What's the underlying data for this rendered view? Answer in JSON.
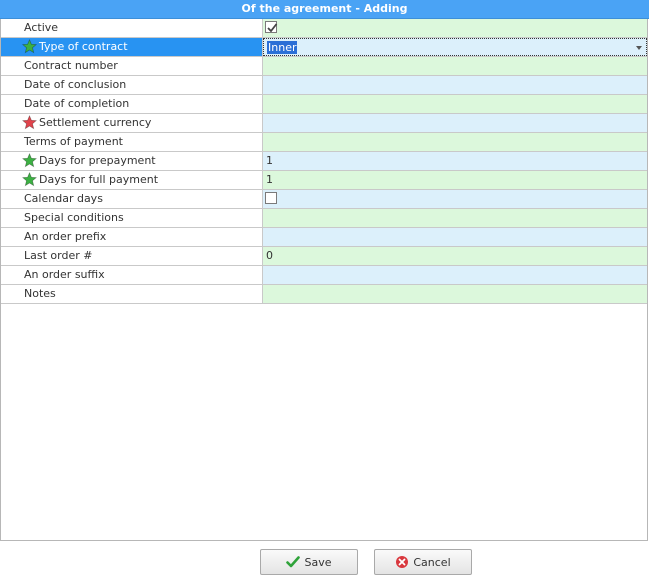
{
  "window": {
    "title": "Of the agreement - Adding"
  },
  "fields": [
    {
      "label": "Active",
      "value": "",
      "type": "checkbox",
      "checked": true,
      "icon": "",
      "bg": "green"
    },
    {
      "label": "Type of contract",
      "value": "Inner",
      "type": "select",
      "icon": "star-green-icon",
      "bg": "blue",
      "selected": true
    },
    {
      "label": "Contract number",
      "value": "",
      "type": "text",
      "icon": "",
      "bg": "green"
    },
    {
      "label": "Date of conclusion",
      "value": "",
      "type": "text",
      "icon": "",
      "bg": "blue"
    },
    {
      "label": "Date of completion",
      "value": "",
      "type": "text",
      "icon": "",
      "bg": "green"
    },
    {
      "label": "Settlement currency",
      "value": "",
      "type": "text",
      "icon": "star-red-icon",
      "bg": "blue"
    },
    {
      "label": "Terms of payment",
      "value": "",
      "type": "text",
      "icon": "",
      "bg": "green"
    },
    {
      "label": "Days for prepayment",
      "value": "1",
      "type": "text",
      "icon": "star-green-icon",
      "bg": "blue"
    },
    {
      "label": "Days for full payment",
      "value": "1",
      "type": "text",
      "icon": "star-green-icon",
      "bg": "green"
    },
    {
      "label": "Calendar days",
      "value": "",
      "type": "checkbox",
      "checked": false,
      "icon": "",
      "bg": "blue"
    },
    {
      "label": "Special conditions",
      "value": "",
      "type": "text",
      "icon": "",
      "bg": "green"
    },
    {
      "label": "An order prefix",
      "value": "",
      "type": "text",
      "icon": "",
      "bg": "blue"
    },
    {
      "label": "Last order #",
      "value": "0",
      "type": "text",
      "icon": "",
      "bg": "green"
    },
    {
      "label": "An order suffix",
      "value": "",
      "type": "text",
      "icon": "",
      "bg": "blue"
    },
    {
      "label": "Notes",
      "value": "",
      "type": "text",
      "icon": "",
      "bg": "green"
    }
  ],
  "buttons": {
    "save": {
      "label": "Save",
      "icon": "checkmark-green-icon"
    },
    "cancel": {
      "label": "Cancel",
      "icon": "cancel-red-icon"
    }
  },
  "colors": {
    "title_bg": "#4aa3f5",
    "selected_row": "#2893f2",
    "row_green": "#dcf8dc",
    "row_blue": "#dcf0fb",
    "star_green": "#3cb043",
    "star_red": "#e0434b"
  }
}
